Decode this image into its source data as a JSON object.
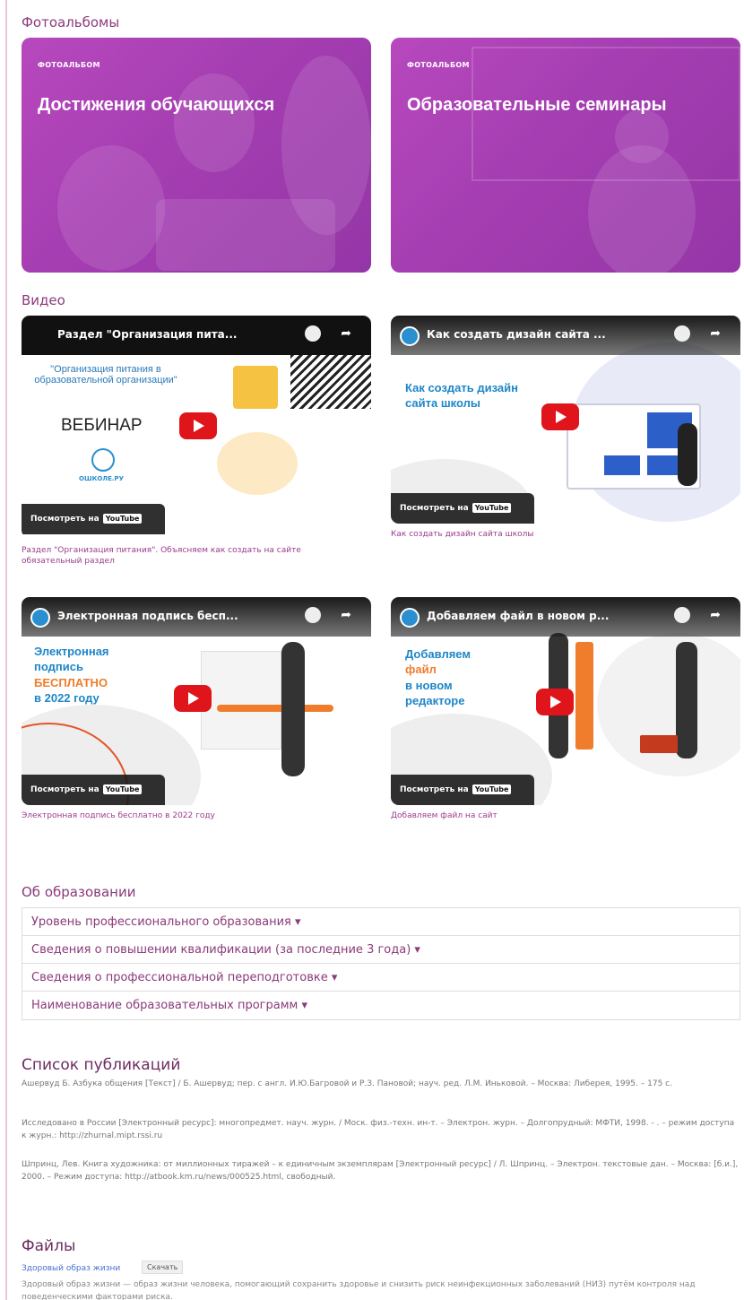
{
  "photo_section": {
    "title": "Фотоальбомы"
  },
  "albums": [
    {
      "kicker": "ФОТОАЛЬБОМ",
      "title": "Достижения обучающихся"
    },
    {
      "kicker": "ФОТОАЛЬБОМ",
      "title": "Образовательные семинары"
    }
  ],
  "video_section": {
    "title": "Видео"
  },
  "videos": [
    {
      "title": "Раздел \"Организация пита...",
      "headline": "\"Организация питания в образовательной организации\"",
      "sub": "ВЕБИНАР",
      "logo": "ОШКОЛЕ.РУ",
      "watch": "Посмотреть на",
      "yt": "YouTube",
      "caption": "Раздел \"Организация питания\". Объясняем как создать на сайте обязательный раздел"
    },
    {
      "title": "Как создать дизайн сайта ...",
      "headline": "Как создать дизайн сайта школы",
      "watch": "Посмотреть на",
      "yt": "YouTube",
      "caption": "Как создать дизайн сайта школы"
    },
    {
      "title": "Электронная подпись бесп...",
      "headline": "Электронная подпись",
      "headline_accent": "БЕСПЛАТНО",
      "headline_tail": "в 2022 году",
      "watch": "Посмотреть на",
      "yt": "YouTube",
      "caption": "Электронная подпись бесплатно в 2022 году"
    },
    {
      "title": "Добавляем файл в новом р...",
      "headline": "Добавляем",
      "headline_accent": "файл",
      "headline_tail": "в новом редакторе",
      "watch": "Посмотреть на",
      "yt": "YouTube",
      "caption": "Добавляем файл на сайт"
    }
  ],
  "education": {
    "title": "Об образовании",
    "items": [
      "Уровень профессионального образования ▾",
      "Сведения о повышении квалификации (за последние 3 года) ▾",
      "Сведения о профессиональной переподготовке ▾",
      "Наименование образовательных программ ▾"
    ]
  },
  "publications": {
    "title": "Список публикаций",
    "items": [
      "Ашервуд Б. Азбука общения [Текст] / Б. Ашервуд; пер. с англ. И.Ю.Багровой и Р.З. Пановой; науч. ред. Л.М. Иньковой. – Москва: Либерея, 1995. – 175 с.",
      "Исследовано в России [Электронный ресурс]: многопредмет. науч. журн. / Моск. физ.-техн. ин-т. – Электрон. журн. – Долгопрудный: МФТИ, 1998. - . – режим доступа к журн.: http://zhurnal.mipt.rssi.ru",
      "Шпринц, Лев. Книга художника: от миллионных тиражей – к единичным экземплярам [Электронный ресурс] / Л. Шпринц. – Электрон. текстовые дан. – Москва: [б.и.], 2000. – Режим доступа: http://atbook.km.ru/news/000525.html, свободный."
    ]
  },
  "files": {
    "title": "Файлы",
    "link": "Здоровый образ жизни",
    "download": "Скачать",
    "description": "Здоровый образ жизни — образ жизни человека, помогающий сохранить здоровье и снизить риск неинфекционных заболеваний (НИЗ) путём контроля над поведенческими факторами риска."
  }
}
